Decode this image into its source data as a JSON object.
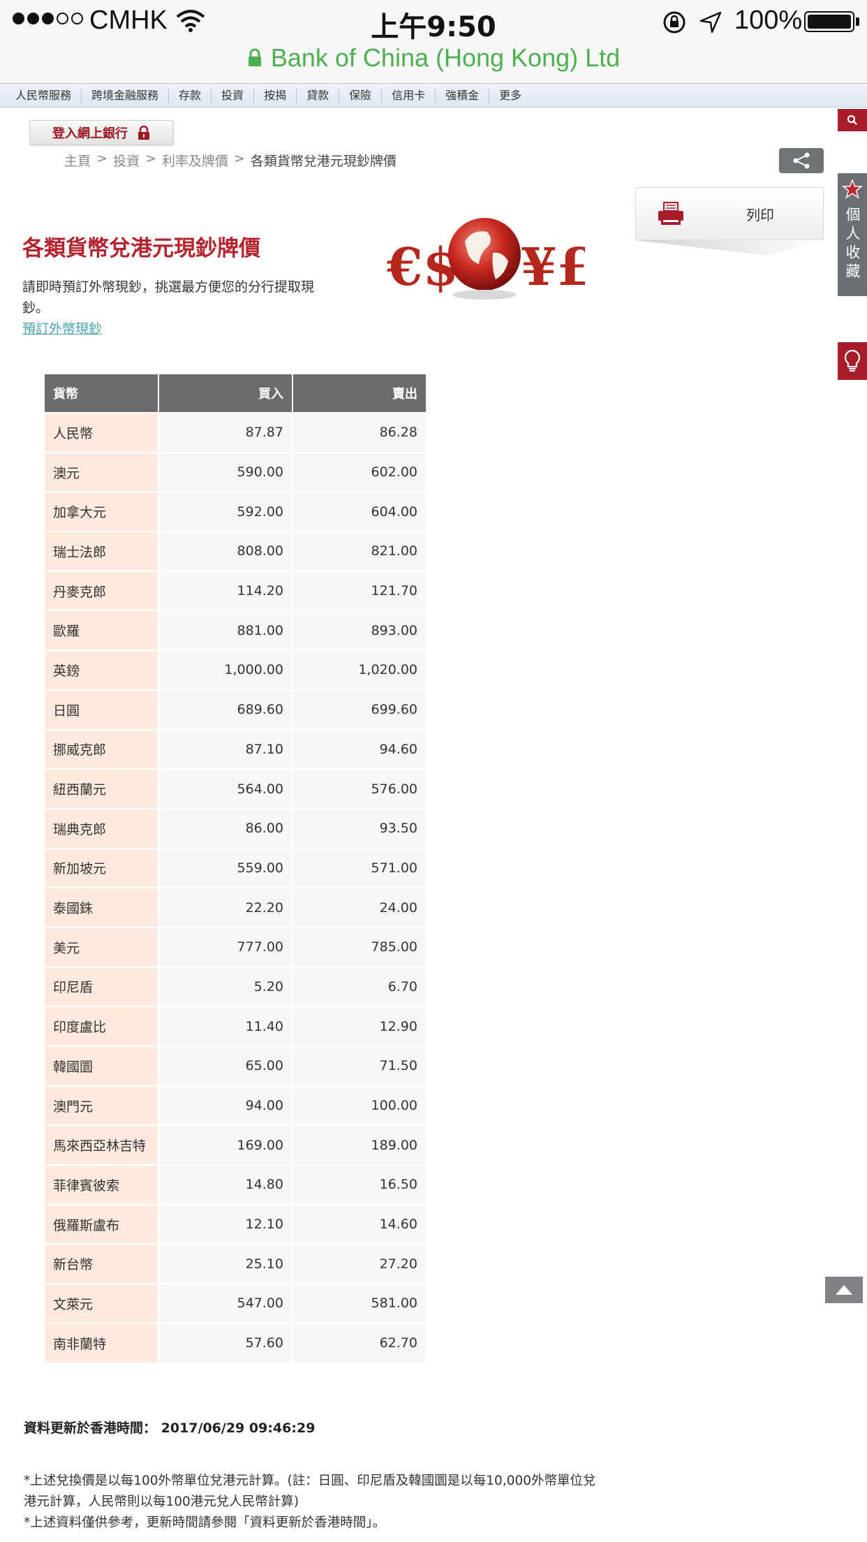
{
  "status_bar": {
    "carrier": "CMHK",
    "time": "上午9:50",
    "battery": "100%"
  },
  "url_bar": {
    "site": "Bank of China (Hong Kong) Ltd"
  },
  "nav": {
    "items": [
      "人民幣服務",
      "跨境金融服務",
      "存款",
      "投資",
      "按揭",
      "貸款",
      "保險",
      "信用卡",
      "強積金",
      "更多"
    ]
  },
  "login": {
    "label": "登入網上銀行"
  },
  "breadcrumb": {
    "items": [
      "主頁",
      "投資",
      "利率及牌價"
    ],
    "separator": ">",
    "current": "各類貨幣兌港元現鈔牌價"
  },
  "print": {
    "label": "列印"
  },
  "side": {
    "favorites": "個人收藏"
  },
  "header": {
    "title": "各類貨幣兌港元現鈔牌價",
    "intro": "請即時預訂外幣現鈔，挑選最方便您的分行提取現鈔。",
    "link": "預訂外幣現鈔"
  },
  "hero": {
    "left_symbols": "€$",
    "right_symbols": "¥£"
  },
  "table": {
    "headers": [
      "貨幣",
      "買入",
      "賣出"
    ],
    "rows": [
      [
        "人民幣",
        "87.87",
        "86.28"
      ],
      [
        "澳元",
        "590.00",
        "602.00"
      ],
      [
        "加拿大元",
        "592.00",
        "604.00"
      ],
      [
        "瑞士法郎",
        "808.00",
        "821.00"
      ],
      [
        "丹麥克郎",
        "114.20",
        "121.70"
      ],
      [
        "歐羅",
        "881.00",
        "893.00"
      ],
      [
        "英鎊",
        "1,000.00",
        "1,020.00"
      ],
      [
        "日圓",
        "689.60",
        "699.60"
      ],
      [
        "挪威克郎",
        "87.10",
        "94.60"
      ],
      [
        "紐西蘭元",
        "564.00",
        "576.00"
      ],
      [
        "瑞典克郎",
        "86.00",
        "93.50"
      ],
      [
        "新加坡元",
        "559.00",
        "571.00"
      ],
      [
        "泰國銖",
        "22.20",
        "24.00"
      ],
      [
        "美元",
        "777.00",
        "785.00"
      ],
      [
        "印尼盾",
        "5.20",
        "6.70"
      ],
      [
        "印度盧比",
        "11.40",
        "12.90"
      ],
      [
        "韓國圜",
        "65.00",
        "71.50"
      ],
      [
        "澳門元",
        "94.00",
        "100.00"
      ],
      [
        "馬來西亞林吉特",
        "169.00",
        "189.00"
      ],
      [
        "菲律賓彼索",
        "14.80",
        "16.50"
      ],
      [
        "俄羅斯盧布",
        "12.10",
        "14.60"
      ],
      [
        "新台幣",
        "25.10",
        "27.20"
      ],
      [
        "文萊元",
        "547.00",
        "581.00"
      ],
      [
        "南非蘭特",
        "57.60",
        "62.70"
      ]
    ]
  },
  "footer": {
    "updated_label": "資料更新於香港時間：",
    "updated_value": "2017/06/29 09:46:29",
    "note1": "*上述兌換價是以每100外幣單位兌港元計算。(註：日圓、印尼盾及韓國圜是以每10,000外幣單位兌港元計算，人民幣則以每100港元兌人民幣計算)",
    "note2": "*上述資料僅供參考，更新時間請參閱「資料更新於香港時間」。"
  },
  "colors": {
    "brand_red": "#b3222d",
    "url_green": "#4caf50",
    "link_teal": "#4aa3b0",
    "table_header": "#6c6c6c",
    "currency_cell": "#fde9dd"
  }
}
